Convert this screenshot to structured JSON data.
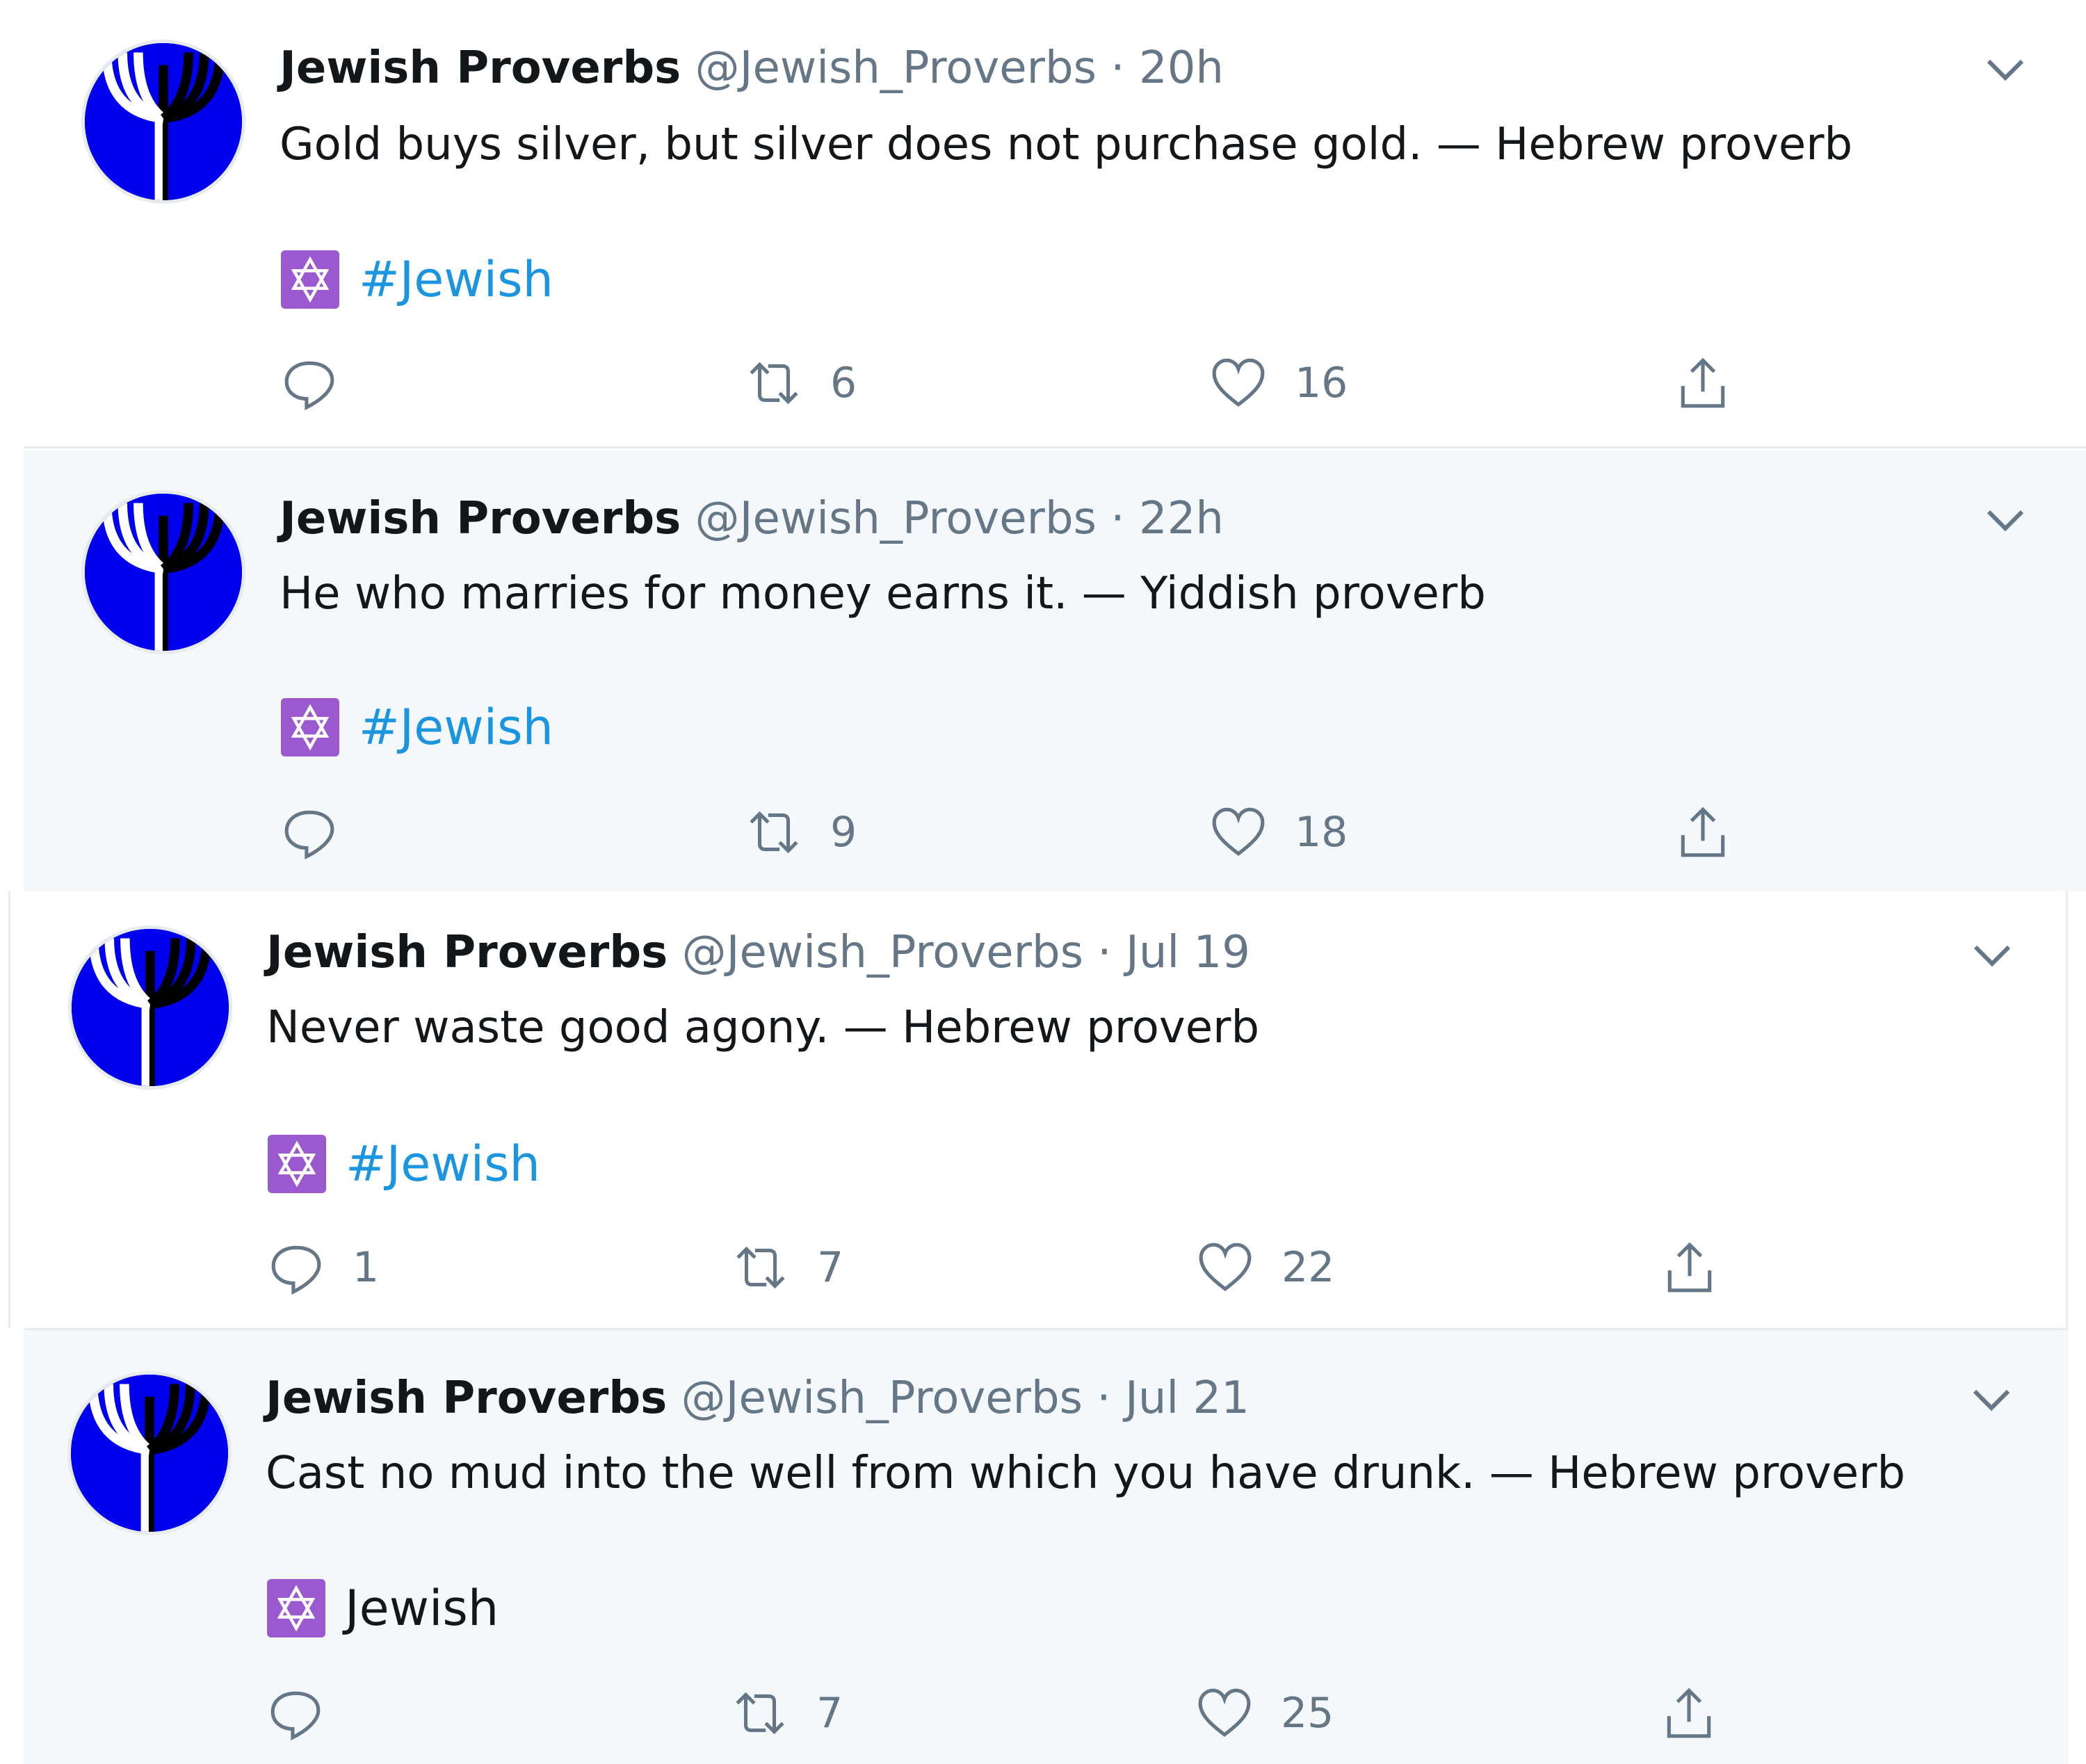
{
  "colors": {
    "link": "#1b95e0",
    "muted": "#657786",
    "gray_bg": "#f5f8fa",
    "emoji_bg": "#9b59d0",
    "avatar_blue": "#0000ee"
  },
  "tweets": [
    {
      "name": "Jewish Proverbs",
      "handle": "@Jewish_Proverbs",
      "sep": "·",
      "time": "20h",
      "text": "Gold buys silver, but silver does not purchase gold. — Hebrew proverb",
      "tag": "#Jewish",
      "reply_count": "",
      "retweet_count": "6",
      "like_count": "16"
    },
    {
      "name": "Jewish Proverbs",
      "handle": "@Jewish_Proverbs",
      "sep": "·",
      "time": "22h",
      "text": "He who marries for money earns it. — Yiddish proverb",
      "tag": "#Jewish",
      "reply_count": "",
      "retweet_count": "9",
      "like_count": "18"
    },
    {
      "name": "Jewish Proverbs",
      "handle": "@Jewish_Proverbs",
      "sep": "·",
      "time": "Jul 19",
      "text": "Never waste good agony. — Hebrew proverb",
      "tag": "#Jewish",
      "reply_count": "1",
      "retweet_count": "7",
      "like_count": "22"
    },
    {
      "name": "Jewish Proverbs",
      "handle": "@Jewish_Proverbs",
      "sep": "·",
      "time": "Jul 21",
      "text": "Cast no mud into the well from which you have drunk. — Hebrew proverb",
      "tag": "Jewish",
      "reply_count": "",
      "retweet_count": "7",
      "like_count": "25"
    }
  ]
}
